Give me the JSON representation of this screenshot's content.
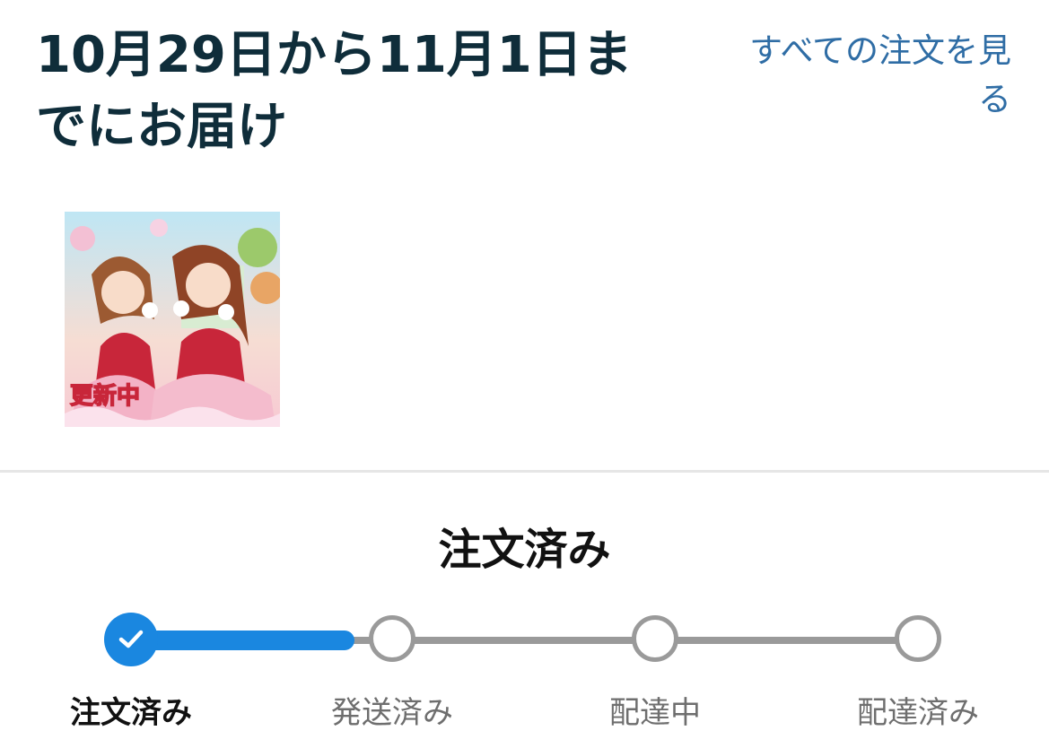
{
  "header": {
    "delivery_title": "10月29日から11月1日までにお届け",
    "all_orders_link": "すべての注文を見る"
  },
  "product": {
    "thumbnail_text": "更新中"
  },
  "status": {
    "current_heading": "注文済み"
  },
  "tracker": {
    "steps": [
      {
        "label": "注文済み",
        "state": "done"
      },
      {
        "label": "発送済み",
        "state": "pending"
      },
      {
        "label": "配達中",
        "state": "pending"
      },
      {
        "label": "配達済み",
        "state": "pending"
      }
    ],
    "progress_fraction": 0.1,
    "colors": {
      "done": "#1a87e0",
      "pending": "#9a9a9a"
    }
  }
}
